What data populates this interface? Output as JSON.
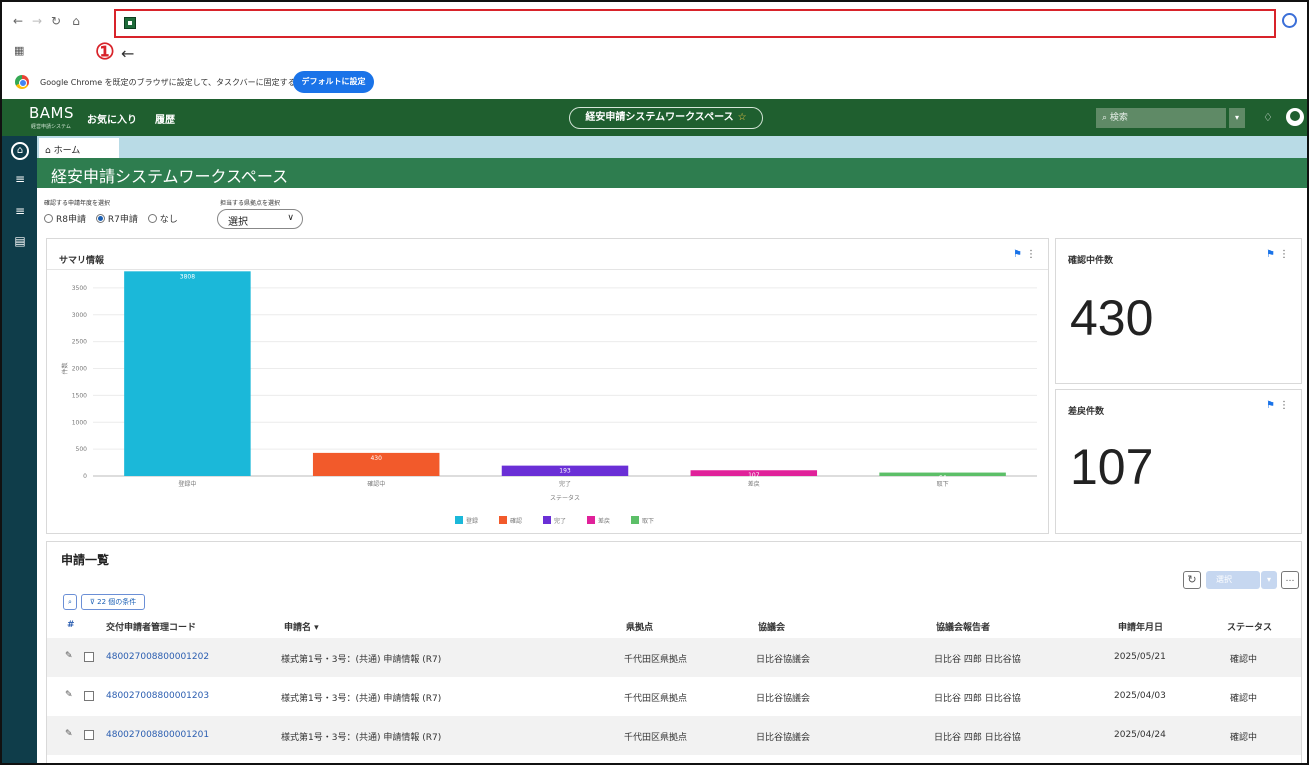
{
  "browser": {
    "annotation_marker": "①",
    "infobar_text": "Google Chrome を既定のブラウザに設定して、タスクバーに固定する",
    "default_button": "デフォルトに設定"
  },
  "header": {
    "logo": "BAMS",
    "logo_sub": "経営申請システム",
    "nav": [
      "お気に入り",
      "履歴"
    ],
    "workspace_pill": "経安申請システムワークスペース",
    "search_placeholder": "検索"
  },
  "tabs": {
    "home": "ホーム"
  },
  "workspace_title": "経安申請システムワークスペース",
  "filters": {
    "year_label": "確認する申請年度を選択",
    "year_options": [
      "R8申請",
      "R7申請",
      "なし"
    ],
    "year_selected": "R7申請",
    "office_label": "担当する県拠点を選択",
    "office_value": "選択"
  },
  "summary_card": {
    "title": "サマリ情報"
  },
  "chart_data": {
    "type": "bar",
    "categories": [
      "登録中",
      "確認中",
      "完了",
      "差戻",
      "取下"
    ],
    "values": [
      3808,
      430,
      193,
      107,
      64
    ],
    "colors": [
      "#1bb8d9",
      "#f25a2b",
      "#6a2fd6",
      "#e0219a",
      "#5cbf68"
    ],
    "xlabel": "ステータス",
    "ylabel": "件数",
    "ylim": [
      0,
      4000
    ],
    "yticks": [
      0,
      500,
      1000,
      1500,
      2000,
      2500,
      3000,
      3500
    ],
    "legend": [
      "登録",
      "確認",
      "完了",
      "差戻",
      "取下"
    ]
  },
  "kpi_cards": [
    {
      "title": "確認中件数",
      "value": "430"
    },
    {
      "title": "差戻件数",
      "value": "107"
    }
  ],
  "list": {
    "title": "申請一覧",
    "filter_chip": "22 個の条件",
    "select_button": "選択",
    "columns": [
      "交付申請者管理コード",
      "申請名 ▾",
      "県拠点",
      "協議会",
      "協議会報告者",
      "申請年月日",
      "ステータス"
    ],
    "rows": [
      [
        "480027008800001202",
        "様式第1号・3号：(共通) 申請情報 (R7)",
        "千代田区県拠点",
        "日比谷協議会",
        "日比谷 四郎 日比谷協",
        "2025/05/21",
        "確認中"
      ],
      [
        "480027008800001203",
        "様式第1号・3号：(共通) 申請情報 (R7)",
        "千代田区県拠点",
        "日比谷協議会",
        "日比谷 四郎 日比谷協",
        "2025/04/03",
        "確認中"
      ],
      [
        "480027008800001201",
        "様式第1号・3号：(共通) 申請情報 (R7)",
        "千代田区県拠点",
        "日比谷協議会",
        "日比谷 四郎 日比谷協",
        "2025/04/24",
        "確認中"
      ]
    ]
  }
}
